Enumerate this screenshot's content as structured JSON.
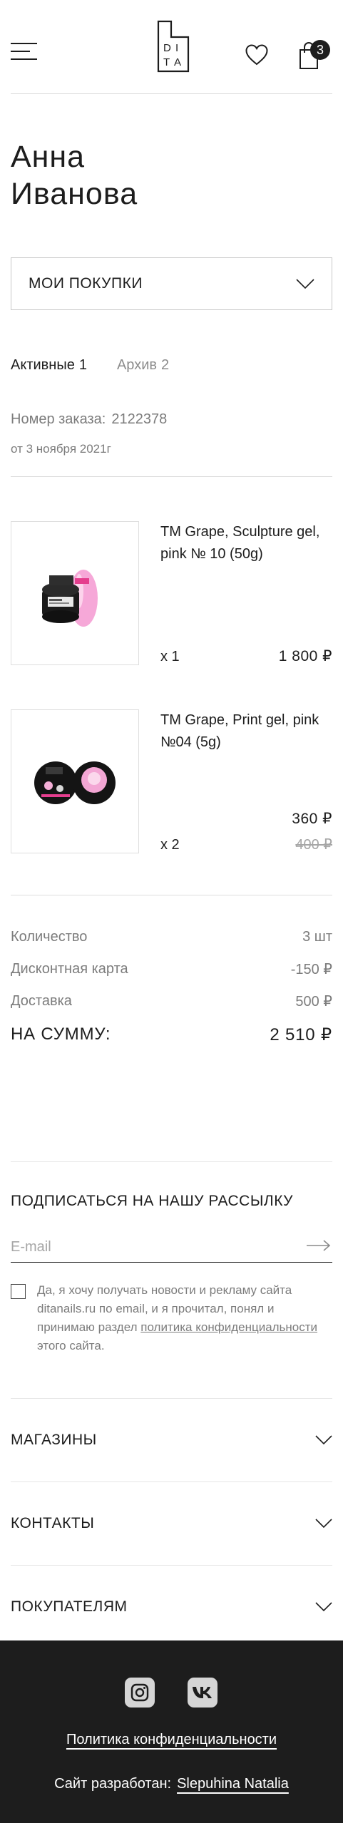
{
  "header": {
    "logo_letters": [
      "D",
      "I",
      "T",
      "A"
    ],
    "cart_count": "3"
  },
  "profile": {
    "first_name": "Анна",
    "last_name": "Иванова"
  },
  "section_select": {
    "selected": "МОИ ПОКУПКИ"
  },
  "tabs": [
    {
      "label": "Активные",
      "count": "1"
    },
    {
      "label": "Архив",
      "count": "2"
    }
  ],
  "order": {
    "number_label": "Номер заказа:",
    "number": "2122378",
    "date": "от 3 ноября 2021г"
  },
  "products": [
    {
      "name": "TM Grape, Sculpture gel, pink № 10 (50g)",
      "qty": "x 1",
      "price": "1 800 ₽"
    },
    {
      "name": "TM Grape, Print gel, pink №04 (5g)",
      "qty": "x 2",
      "price": "360 ₽",
      "old_price": "400 ₽"
    }
  ],
  "summary": {
    "rows": [
      {
        "label": "Количество",
        "value": "3 шт"
      },
      {
        "label": "Дисконтная карта",
        "value": "-150 ₽"
      },
      {
        "label": "Доставка",
        "value": "500 ₽"
      }
    ],
    "total_label": "НА СУММУ:",
    "total_value": "2 510 ₽"
  },
  "newsletter": {
    "title": "ПОДПИСАТЬСЯ НА НАШУ РАССЫЛКУ",
    "placeholder": "E-mail",
    "consent_text": "Да, я хочу получать новости и рекламу сайта ditanails.ru по email, и я прочитал, понял и принимаю раздел",
    "consent_link": "политика конфиденциальности",
    "consent_tail": "этого сайта."
  },
  "accordions": [
    {
      "label": "МАГАЗИНЫ"
    },
    {
      "label": "КОНТАКТЫ"
    },
    {
      "label": "ПОКУПАТЕЛЯМ"
    }
  ],
  "footer": {
    "policy": "Политика конфиденциальности",
    "credit_label": "Сайт разработан:",
    "credit_name": "Slepuhina Natalia"
  }
}
